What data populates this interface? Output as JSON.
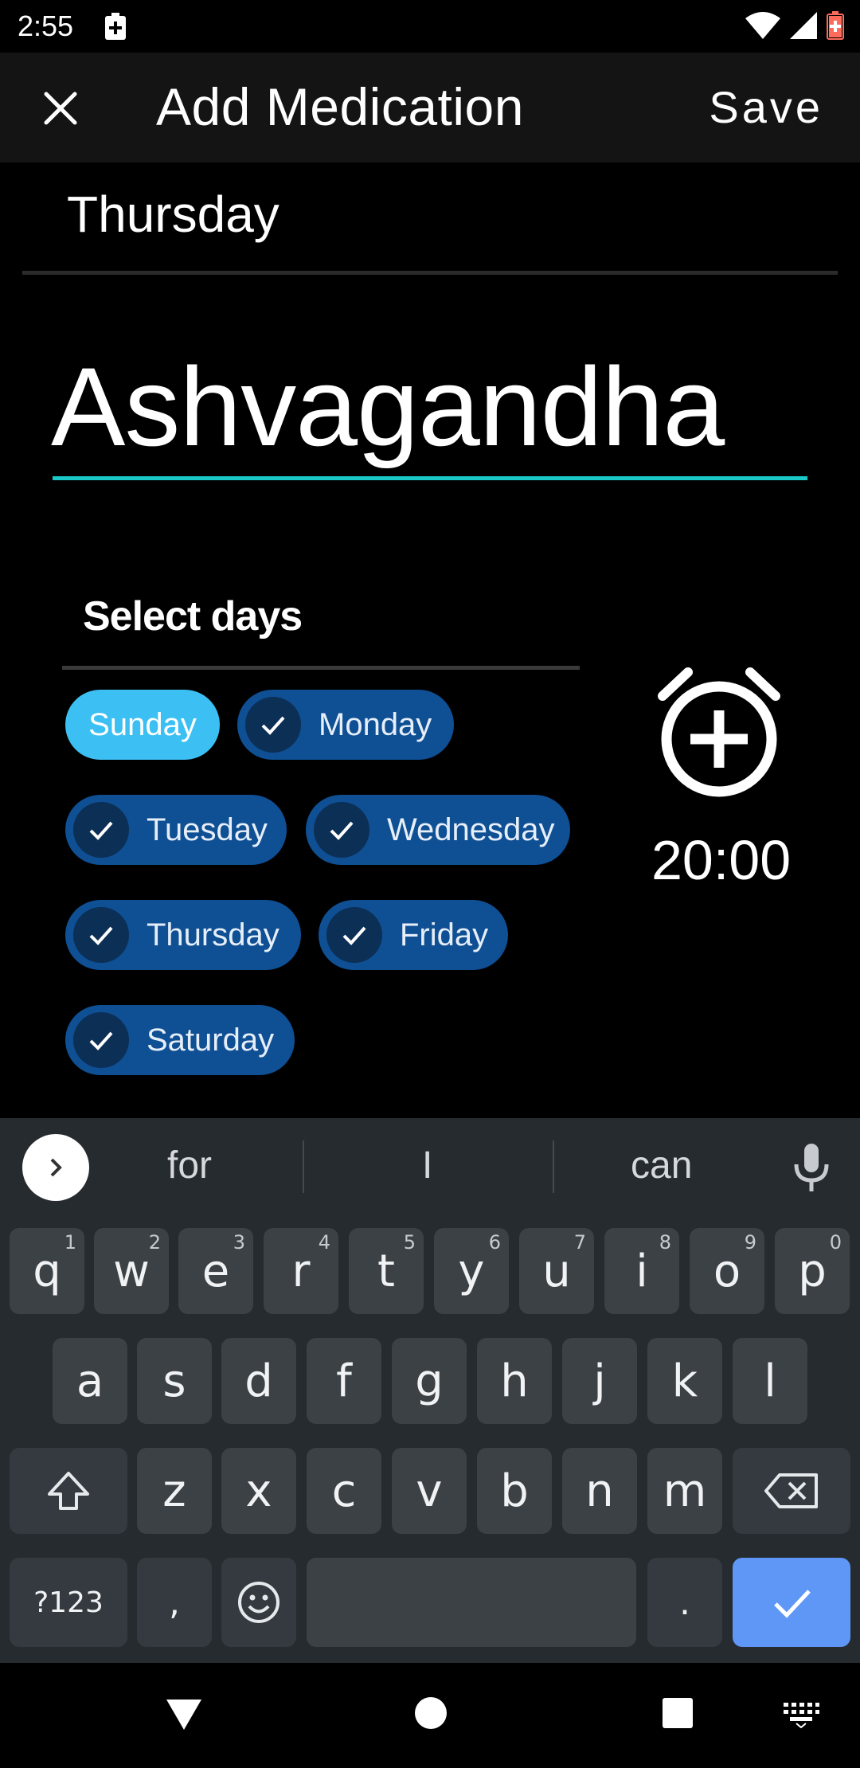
{
  "status": {
    "time": "2:55"
  },
  "toolbar": {
    "title": "Add Medication",
    "save_label": "Save"
  },
  "content": {
    "day_heading": "Thursday",
    "medication_name": "Ashvagandha",
    "select_days_label": "Select days",
    "days": [
      {
        "label": "Sunday",
        "checked": false
      },
      {
        "label": "Monday",
        "checked": true
      },
      {
        "label": "Tuesday",
        "checked": true
      },
      {
        "label": "Wednesday",
        "checked": true
      },
      {
        "label": "Thursday",
        "checked": true
      },
      {
        "label": "Friday",
        "checked": true
      },
      {
        "label": "Saturday",
        "checked": true
      }
    ],
    "alarm_time": "20:00"
  },
  "keyboard": {
    "suggestions": [
      "for",
      "I",
      "can"
    ],
    "row1": [
      {
        "key": "q",
        "hint": "1"
      },
      {
        "key": "w",
        "hint": "2"
      },
      {
        "key": "e",
        "hint": "3"
      },
      {
        "key": "r",
        "hint": "4"
      },
      {
        "key": "t",
        "hint": "5"
      },
      {
        "key": "y",
        "hint": "6"
      },
      {
        "key": "u",
        "hint": "7"
      },
      {
        "key": "i",
        "hint": "8"
      },
      {
        "key": "o",
        "hint": "9"
      },
      {
        "key": "p",
        "hint": "0"
      }
    ],
    "row2": [
      "a",
      "s",
      "d",
      "f",
      "g",
      "h",
      "j",
      "k",
      "l"
    ],
    "row3": [
      "z",
      "x",
      "c",
      "v",
      "b",
      "n",
      "m"
    ],
    "symbols_label": "?123",
    "comma": ",",
    "period": "."
  },
  "colors": {
    "accent_underline": "#1ac8c8",
    "chip_selected": "#0f4f94",
    "chip_highlight": "#3cbff2",
    "keyboard_action": "#5e97f6"
  }
}
